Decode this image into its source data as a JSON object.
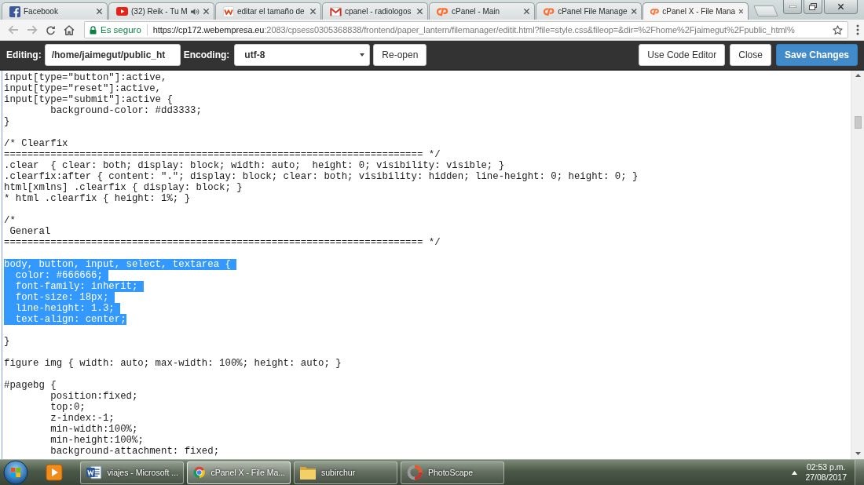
{
  "browser": {
    "tabs": [
      {
        "title": "Facebook",
        "kind": "f-logo",
        "audio": false,
        "selected": false
      },
      {
        "title": "(32) Reik - Tu M",
        "kind": "play",
        "audio": true,
        "selected": false
      },
      {
        "title": "editar el tamaño de",
        "kind": "tile",
        "audio": false,
        "selected": false
      },
      {
        "title": "cpanel - radiologos",
        "kind": "envelope",
        "audio": false,
        "selected": false
      },
      {
        "title": "cPanel - Main",
        "kind": "logo",
        "audio": false,
        "selected": false
      },
      {
        "title": "cPanel File Manage",
        "kind": "logo",
        "audio": false,
        "selected": false
      },
      {
        "title": "cPanel X - File Mana",
        "kind": "logo",
        "audio": false,
        "selected": true
      }
    ],
    "address_bar": {
      "security_label": "Es seguro",
      "url_host": "https://cp172.webempresa.eu",
      "url_rest": ":2083/cpsess0305368838/frontend/paper_lantern/filemanager/editit.html?file=style.css&fileop=&dir=%2Fhome%2Fjaimegut%2Fpublic_html%"
    }
  },
  "editor_toolbar": {
    "editing_label": "Editing:",
    "path": "/home/jaimegut/public_ht",
    "encoding_label": "Encoding:",
    "encoding": "utf-8",
    "reopen_button": "Re-open",
    "buttons": [
      {
        "label": "Use Code Editor",
        "primary": false
      },
      {
        "label": "Close",
        "primary": false
      },
      {
        "label": "Save Changes",
        "primary": true
      }
    ]
  },
  "editor": {
    "blocks": [
      {
        "lines": [
          {
            "text": "input[type=\"button\"]:active,",
            "selected": false
          },
          {
            "text": "input[type=\"reset\"]:active,",
            "selected": false
          },
          {
            "text": "input[type=\"submit\"]:active {",
            "selected": false
          },
          {
            "text": "\tbackground-color: #dd3333;",
            "selected": false
          },
          {
            "text": "}",
            "selected": false
          }
        ]
      },
      {
        "lines": [
          {
            "text": "/* Clearfix",
            "selected": false
          },
          {
            "text": "======================================================================== */",
            "selected": false
          },
          {
            "text": ".clear  { clear: both; display: block; width: auto;  height: 0; visibility: visible; }",
            "selected": false
          },
          {
            "text": ".clearfix:after { content: \".\"; display: block; clear: both; visibility: hidden; line-height: 0; height: 0; }",
            "selected": false
          },
          {
            "text": "html[xmlns] .clearfix { display: block; }",
            "selected": false
          },
          {
            "text": "* html .clearfix { height: 1%; }",
            "selected": false
          }
        ]
      },
      {
        "lines": [
          {
            "text": "/*",
            "selected": false
          },
          {
            "text": " General",
            "selected": false
          },
          {
            "text": "======================================================================== */",
            "selected": false
          }
        ]
      },
      {
        "lines": [
          {
            "text": "body, button, input, select, textarea {",
            "selected": true
          },
          {
            "text": "  color: #666666;",
            "selected": true
          },
          {
            "text": "  font-family: inherit;",
            "selected": true
          },
          {
            "text": "  font-size: 18px;",
            "selected": true
          },
          {
            "text": "  line-height: 1.3;",
            "selected": true
          },
          {
            "text": "  text-align: center;",
            "selected": true
          }
        ]
      },
      {
        "lines": [
          {
            "text": "}",
            "selected": false
          }
        ]
      },
      {
        "lines": [
          {
            "text": "figure img { width: auto; max-width: 100%; height: auto; }",
            "selected": false
          }
        ]
      },
      {
        "lines": [
          {
            "text": "#pagebg {",
            "selected": false
          },
          {
            "text": "\tposition:fixed;",
            "selected": false
          },
          {
            "text": "\ttop:0;",
            "selected": false
          },
          {
            "text": "\tz-index:-1;",
            "selected": false
          },
          {
            "text": "\tmin-width:100%;",
            "selected": false
          },
          {
            "text": "\tmin-height:100%;",
            "selected": false
          },
          {
            "text": "\tbackground-attachment: fixed;",
            "selected": false
          }
        ]
      }
    ]
  },
  "taskbar": {
    "tasks": [
      {
        "label": "viajes - Microsoft ...",
        "kind": "document",
        "selected": false
      },
      {
        "label": "cPanel X - File Ma...",
        "kind": "tricolor-circle",
        "selected": true
      },
      {
        "label": "subirchur",
        "kind": "folder",
        "selected": false
      },
      {
        "label": "PhotoScape",
        "kind": "ring",
        "selected": false
      }
    ],
    "time": "02:53 p.m.",
    "date": "27/08/2017"
  }
}
